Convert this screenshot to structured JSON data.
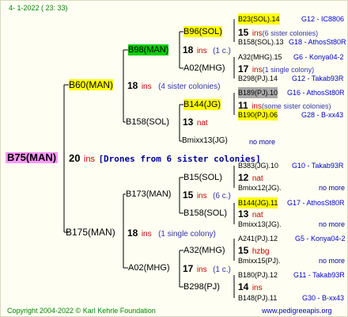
{
  "header": {
    "date": "4-  1-2022 ( 23: 33)"
  },
  "root": {
    "name": "B75(MAN)",
    "count": "20",
    "unit": "ins",
    "note": "[Drones from 6 sister colonies]"
  },
  "gen1": [
    {
      "name": "B60(MAN)",
      "count": "18",
      "unit": "ins",
      "note": "(4 sister colonies)"
    },
    {
      "name": "B175(MAN)",
      "count": "18",
      "unit": "ins",
      "note": "(1 single colony)"
    }
  ],
  "gen2": [
    {
      "name": "B98(MAN)",
      "count": "18",
      "unit": "ins",
      "note": "(1 c.)"
    },
    {
      "name": "B158(SOL)",
      "count": "13",
      "unit": "nat",
      "note": ""
    },
    {
      "name": "B173(MAN)",
      "count": "15",
      "unit": "ins",
      "note": "(6 c.)"
    },
    {
      "name": "A02(MHG)",
      "count": "17",
      "unit": "ins",
      "note": "(1 c.)"
    }
  ],
  "gen3": [
    {
      "name": "B96(SOL)",
      "count": "15",
      "unit": "ins",
      "note": "(6 sister colonies)"
    },
    {
      "name": "A02(MHG)",
      "count": "17",
      "unit": "ins",
      "note": "(1 single colony)"
    },
    {
      "name": "B144(JG)",
      "count": "11",
      "unit": "ins",
      "note": "(some sister colonies)"
    },
    {
      "name": "Bmixx13(JG)",
      "count": "",
      "unit": "",
      "note": "no more"
    },
    {
      "name": "B15(SOL)",
      "count": "12",
      "unit": "nat",
      "note": ""
    },
    {
      "name": "B158(SOL)",
      "count": "13",
      "unit": "nat",
      "note": ""
    },
    {
      "name": "A32(MHG)",
      "count": "15",
      "unit": "hzbg",
      "note": ""
    },
    {
      "name": "B298(PJ)",
      "count": "14",
      "unit": "ins",
      "note": ""
    }
  ],
  "gen4": [
    {
      "name": "B23(SOL).14",
      "info": "G12 - IC8806"
    },
    {
      "name": "B158(SOL).13",
      "info": "G18 - AthosSt80R"
    },
    {
      "name": "A32(MHG).15",
      "info": "G6 - Konya04-2"
    },
    {
      "name": "B298(PJ).14",
      "info": "G12 - Takab93R"
    },
    {
      "name": "B189(PJ).10",
      "info": "G16 - AthosSt80R"
    },
    {
      "name": "B190(PJ).06",
      "info": "G28 - B-xx43"
    },
    {
      "name": "B383(JG).10",
      "info": "G10 - Takab93R"
    },
    {
      "name": "Bmixx12(JG).",
      "info": "no more"
    },
    {
      "name": "B144(JG).11",
      "info": "G17 - AthosSt80R"
    },
    {
      "name": "Bmixx13(JG).",
      "info": "no more"
    },
    {
      "name": "A241(PJ).12",
      "info": "G5 - Konya04-2"
    },
    {
      "name": "Bmixx15(PJ).",
      "info": "no more"
    },
    {
      "name": "B180(PJ).12",
      "info": "G11 - Takab93R"
    },
    {
      "name": "B148(PJ).11",
      "info": "G30 - B-xx43"
    }
  ],
  "footer": {
    "copyright": "Copyright 2004-2022 © Karl Kehrle Foundation",
    "url": "www.pedigreeapis.org"
  },
  "colors": {
    "root_bg": "#ff99ff",
    "highlight": "#ffff00",
    "green": "#00cc00",
    "gray": "#aaaaaa"
  }
}
